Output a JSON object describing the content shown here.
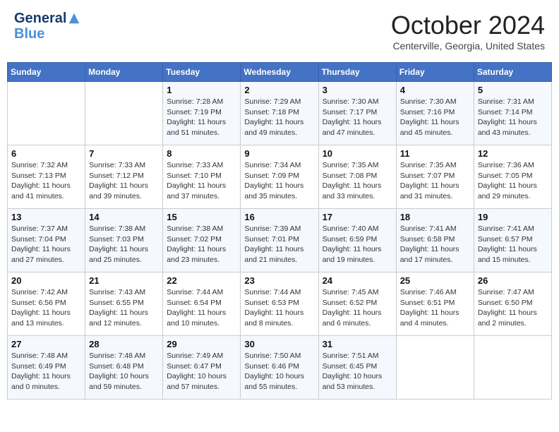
{
  "header": {
    "logo_line1": "General",
    "logo_line2": "Blue",
    "main_title": "October 2024",
    "subtitle": "Centerville, Georgia, United States"
  },
  "days_of_week": [
    "Sunday",
    "Monday",
    "Tuesday",
    "Wednesday",
    "Thursday",
    "Friday",
    "Saturday"
  ],
  "weeks": [
    [
      {
        "day": "",
        "sunrise": "",
        "sunset": "",
        "daylight": ""
      },
      {
        "day": "",
        "sunrise": "",
        "sunset": "",
        "daylight": ""
      },
      {
        "day": "1",
        "sunrise": "Sunrise: 7:28 AM",
        "sunset": "Sunset: 7:19 PM",
        "daylight": "Daylight: 11 hours and 51 minutes."
      },
      {
        "day": "2",
        "sunrise": "Sunrise: 7:29 AM",
        "sunset": "Sunset: 7:18 PM",
        "daylight": "Daylight: 11 hours and 49 minutes."
      },
      {
        "day": "3",
        "sunrise": "Sunrise: 7:30 AM",
        "sunset": "Sunset: 7:17 PM",
        "daylight": "Daylight: 11 hours and 47 minutes."
      },
      {
        "day": "4",
        "sunrise": "Sunrise: 7:30 AM",
        "sunset": "Sunset: 7:16 PM",
        "daylight": "Daylight: 11 hours and 45 minutes."
      },
      {
        "day": "5",
        "sunrise": "Sunrise: 7:31 AM",
        "sunset": "Sunset: 7:14 PM",
        "daylight": "Daylight: 11 hours and 43 minutes."
      }
    ],
    [
      {
        "day": "6",
        "sunrise": "Sunrise: 7:32 AM",
        "sunset": "Sunset: 7:13 PM",
        "daylight": "Daylight: 11 hours and 41 minutes."
      },
      {
        "day": "7",
        "sunrise": "Sunrise: 7:33 AM",
        "sunset": "Sunset: 7:12 PM",
        "daylight": "Daylight: 11 hours and 39 minutes."
      },
      {
        "day": "8",
        "sunrise": "Sunrise: 7:33 AM",
        "sunset": "Sunset: 7:10 PM",
        "daylight": "Daylight: 11 hours and 37 minutes."
      },
      {
        "day": "9",
        "sunrise": "Sunrise: 7:34 AM",
        "sunset": "Sunset: 7:09 PM",
        "daylight": "Daylight: 11 hours and 35 minutes."
      },
      {
        "day": "10",
        "sunrise": "Sunrise: 7:35 AM",
        "sunset": "Sunset: 7:08 PM",
        "daylight": "Daylight: 11 hours and 33 minutes."
      },
      {
        "day": "11",
        "sunrise": "Sunrise: 7:35 AM",
        "sunset": "Sunset: 7:07 PM",
        "daylight": "Daylight: 11 hours and 31 minutes."
      },
      {
        "day": "12",
        "sunrise": "Sunrise: 7:36 AM",
        "sunset": "Sunset: 7:05 PM",
        "daylight": "Daylight: 11 hours and 29 minutes."
      }
    ],
    [
      {
        "day": "13",
        "sunrise": "Sunrise: 7:37 AM",
        "sunset": "Sunset: 7:04 PM",
        "daylight": "Daylight: 11 hours and 27 minutes."
      },
      {
        "day": "14",
        "sunrise": "Sunrise: 7:38 AM",
        "sunset": "Sunset: 7:03 PM",
        "daylight": "Daylight: 11 hours and 25 minutes."
      },
      {
        "day": "15",
        "sunrise": "Sunrise: 7:38 AM",
        "sunset": "Sunset: 7:02 PM",
        "daylight": "Daylight: 11 hours and 23 minutes."
      },
      {
        "day": "16",
        "sunrise": "Sunrise: 7:39 AM",
        "sunset": "Sunset: 7:01 PM",
        "daylight": "Daylight: 11 hours and 21 minutes."
      },
      {
        "day": "17",
        "sunrise": "Sunrise: 7:40 AM",
        "sunset": "Sunset: 6:59 PM",
        "daylight": "Daylight: 11 hours and 19 minutes."
      },
      {
        "day": "18",
        "sunrise": "Sunrise: 7:41 AM",
        "sunset": "Sunset: 6:58 PM",
        "daylight": "Daylight: 11 hours and 17 minutes."
      },
      {
        "day": "19",
        "sunrise": "Sunrise: 7:41 AM",
        "sunset": "Sunset: 6:57 PM",
        "daylight": "Daylight: 11 hours and 15 minutes."
      }
    ],
    [
      {
        "day": "20",
        "sunrise": "Sunrise: 7:42 AM",
        "sunset": "Sunset: 6:56 PM",
        "daylight": "Daylight: 11 hours and 13 minutes."
      },
      {
        "day": "21",
        "sunrise": "Sunrise: 7:43 AM",
        "sunset": "Sunset: 6:55 PM",
        "daylight": "Daylight: 11 hours and 12 minutes."
      },
      {
        "day": "22",
        "sunrise": "Sunrise: 7:44 AM",
        "sunset": "Sunset: 6:54 PM",
        "daylight": "Daylight: 11 hours and 10 minutes."
      },
      {
        "day": "23",
        "sunrise": "Sunrise: 7:44 AM",
        "sunset": "Sunset: 6:53 PM",
        "daylight": "Daylight: 11 hours and 8 minutes."
      },
      {
        "day": "24",
        "sunrise": "Sunrise: 7:45 AM",
        "sunset": "Sunset: 6:52 PM",
        "daylight": "Daylight: 11 hours and 6 minutes."
      },
      {
        "day": "25",
        "sunrise": "Sunrise: 7:46 AM",
        "sunset": "Sunset: 6:51 PM",
        "daylight": "Daylight: 11 hours and 4 minutes."
      },
      {
        "day": "26",
        "sunrise": "Sunrise: 7:47 AM",
        "sunset": "Sunset: 6:50 PM",
        "daylight": "Daylight: 11 hours and 2 minutes."
      }
    ],
    [
      {
        "day": "27",
        "sunrise": "Sunrise: 7:48 AM",
        "sunset": "Sunset: 6:49 PM",
        "daylight": "Daylight: 11 hours and 0 minutes."
      },
      {
        "day": "28",
        "sunrise": "Sunrise: 7:48 AM",
        "sunset": "Sunset: 6:48 PM",
        "daylight": "Daylight: 10 hours and 59 minutes."
      },
      {
        "day": "29",
        "sunrise": "Sunrise: 7:49 AM",
        "sunset": "Sunset: 6:47 PM",
        "daylight": "Daylight: 10 hours and 57 minutes."
      },
      {
        "day": "30",
        "sunrise": "Sunrise: 7:50 AM",
        "sunset": "Sunset: 6:46 PM",
        "daylight": "Daylight: 10 hours and 55 minutes."
      },
      {
        "day": "31",
        "sunrise": "Sunrise: 7:51 AM",
        "sunset": "Sunset: 6:45 PM",
        "daylight": "Daylight: 10 hours and 53 minutes."
      },
      {
        "day": "",
        "sunrise": "",
        "sunset": "",
        "daylight": ""
      },
      {
        "day": "",
        "sunrise": "",
        "sunset": "",
        "daylight": ""
      }
    ]
  ]
}
